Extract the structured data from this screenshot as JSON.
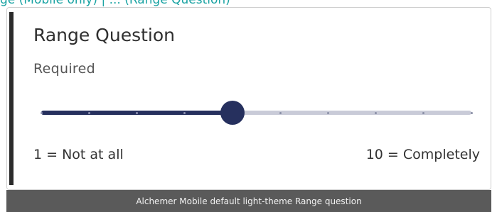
{
  "top_link": {
    "text": "ge (Mobile only) | ... (Range Question)"
  },
  "question": {
    "title": "Range Question",
    "required_label": "Required",
    "range": {
      "min": 1,
      "max": 10,
      "value": 5
    },
    "min_label": "1 = Not at all",
    "max_label": "10 = Completely"
  },
  "caption": "Alchemer Mobile default light-theme Range question",
  "colors": {
    "accent": "#26305e",
    "track": "#c9cbd8",
    "link": "#1aa3a3",
    "caption_bg": "#5a5a5a"
  }
}
